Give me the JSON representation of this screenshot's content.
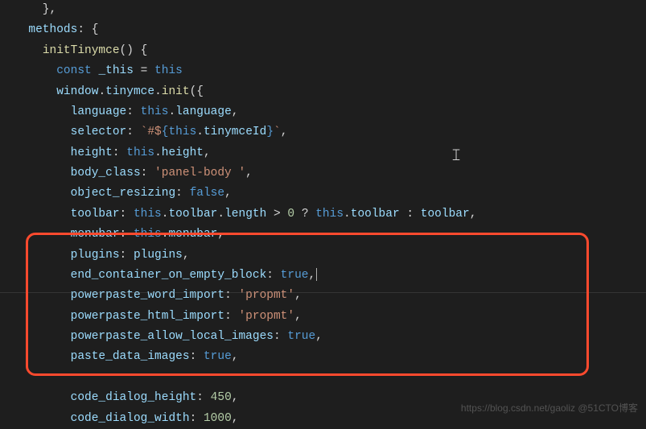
{
  "code": {
    "l0a": "    }",
    "l0b": ",",
    "l1a": "  methods",
    "l1b": ": {",
    "l2a": "    ",
    "l2b": "initTinymce",
    "l2c": "() {",
    "l3a": "      ",
    "l3b": "const",
    "l3c": " ",
    "l3d": "_this",
    "l3e": " = ",
    "l3f": "this",
    "l4a": "      ",
    "l4b": "window",
    "l4c": ".",
    "l4d": "tinymce",
    "l4e": ".",
    "l4f": "init",
    "l4g": "({",
    "l5a": "        ",
    "l5b": "language",
    "l5c": ": ",
    "l5d": "this",
    "l5e": ".",
    "l5f": "language",
    "l5g": ",",
    "l6a": "        ",
    "l6b": "selector",
    "l6c": ": ",
    "l6d": "`#$",
    "l6e": "{",
    "l6f": "this",
    "l6g": ".",
    "l6h": "tinymceId",
    "l6i": "}",
    "l6j": "`",
    "l6k": ",",
    "l7a": "        ",
    "l7b": "height",
    "l7c": ": ",
    "l7d": "this",
    "l7e": ".",
    "l7f": "height",
    "l7g": ",",
    "l8a": "        ",
    "l8b": "body_class",
    "l8c": ": ",
    "l8d": "'panel-body '",
    "l8e": ",",
    "l9a": "        ",
    "l9b": "object_resizing",
    "l9c": ": ",
    "l9d": "false",
    "l9e": ",",
    "l10a": "        ",
    "l10b": "toolbar",
    "l10c": ": ",
    "l10d": "this",
    "l10e": ".",
    "l10f": "toolbar",
    "l10g": ".",
    "l10h": "length",
    "l10i": " > ",
    "l10j": "0",
    "l10k": " ? ",
    "l10l": "this",
    "l10m": ".",
    "l10n": "toolbar",
    "l10o": " : ",
    "l10p": "toolbar",
    "l10q": ",",
    "l11a": "        ",
    "l11b": "menubar",
    "l11c": ": ",
    "l11d": "this",
    "l11e": ".",
    "l11f": "menubar",
    "l11g": ",",
    "l12a": "        ",
    "l12b": "plugins",
    "l12c": ": ",
    "l12d": "plugins",
    "l12e": ",",
    "l13a": "        ",
    "l13b": "end_container_on_empty_block",
    "l13c": ": ",
    "l13d": "true",
    "l13e": ",",
    "l14a": "        ",
    "l14b": "powerpaste_word_import",
    "l14c": ": ",
    "l14d": "'propmt'",
    "l14e": ",",
    "l15a": "        ",
    "l15b": "powerpaste_html_import",
    "l15c": ": ",
    "l15d": "'propmt'",
    "l15e": ",",
    "l16a": "        ",
    "l16b": "powerpaste_allow_local_images",
    "l16c": ": ",
    "l16d": "true",
    "l16e": ",",
    "l17a": "        ",
    "l17b": "paste_data_images",
    "l17c": ": ",
    "l17d": "true",
    "l17e": ",",
    "l18": "",
    "l19a": "        ",
    "l19b": "code_dialog_height",
    "l19c": ": ",
    "l19d": "450",
    "l19e": ",",
    "l20a": "        ",
    "l20b": "code_dialog_width",
    "l20c": ": ",
    "l20d": "1000",
    "l20e": ","
  },
  "watermark": "https://blog.csdn.net/gaoliz\n@51CTO博客"
}
